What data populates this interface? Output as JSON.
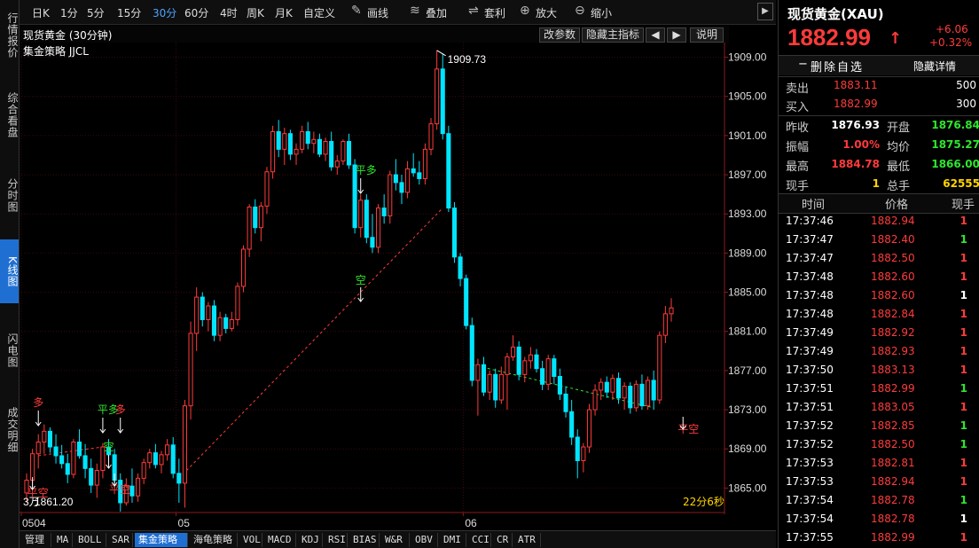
{
  "sidebar": {
    "tabs": [
      {
        "label": "行情报价",
        "active": false
      },
      {
        "label": "综合看盘",
        "active": false
      },
      {
        "label": "分时图",
        "active": false
      },
      {
        "label": "K线图",
        "active": true
      },
      {
        "label": "闪电图",
        "active": false
      },
      {
        "label": "成交明细",
        "active": false
      }
    ]
  },
  "toolbar": {
    "periods": [
      "日K",
      "1分",
      "5分",
      "15分",
      "30分",
      "60分",
      "4时",
      "周K",
      "月K",
      "自定义"
    ],
    "active_period": "30分",
    "tools": [
      {
        "label": "画线",
        "icon": "pencil-icon"
      },
      {
        "label": "叠加",
        "icon": "stack-icon"
      },
      {
        "label": "套利",
        "icon": "arbitrage-icon"
      },
      {
        "label": "放大",
        "icon": "zoom-in-icon"
      },
      {
        "label": "缩小",
        "icon": "zoom-out-icon"
      }
    ],
    "arrow": "▶"
  },
  "chart_header": {
    "title": "现货黄金 (30分钟)",
    "strategy": "集金策略 JJCL",
    "buttons": {
      "params": "改参数",
      "hide": "隐藏主指标",
      "left": "◀",
      "right": "▶",
      "help": "说明"
    }
  },
  "chart_data": {
    "type": "candlestick",
    "ylim": [
      1862.5,
      1910.5
    ],
    "yticks": [
      "1909.00",
      "1905.00",
      "1901.00",
      "1897.00",
      "1893.00",
      "1889.00",
      "1885.00",
      "1881.00",
      "1877.00",
      "1873.00",
      "1869.00",
      "1865.00"
    ],
    "xlabels": [
      "0504",
      "05",
      "06"
    ],
    "high_label": "1909.73",
    "low_label": "1861.20",
    "low_prefix": "3万",
    "countdown": "22分6秒",
    "signals": [
      {
        "text": "多",
        "color": "#ff3b3b"
      },
      {
        "text": "平空",
        "color": "#ff3b3b"
      },
      {
        "text": "平多",
        "color": "#2ee62e"
      },
      {
        "text": "多",
        "color": "#ff3b3b"
      },
      {
        "text": "空",
        "color": "#2ee62e"
      },
      {
        "text": "平空",
        "color": "#ff3b3b"
      },
      {
        "text": "平多",
        "color": "#2ee62e"
      },
      {
        "text": "空",
        "color": "#2ee62e"
      },
      {
        "text": "平空",
        "color": "#ff3b3b"
      }
    ],
    "colors": {
      "up": "#ff3b3b",
      "down": "#00e5ff",
      "grid": "#3a0a0a",
      "axis": "#8b1a1a"
    },
    "candles": [
      [
        1864.5,
        1866.5,
        1863.5,
        1865.8
      ],
      [
        1865.8,
        1869.0,
        1864.8,
        1868.5
      ],
      [
        1868.5,
        1870.5,
        1867.0,
        1869.7
      ],
      [
        1869.7,
        1871.5,
        1868.5,
        1870.8
      ],
      [
        1870.8,
        1871.2,
        1868.6,
        1869.2
      ],
      [
        1869.2,
        1870.5,
        1867.5,
        1868.3
      ],
      [
        1868.3,
        1869.4,
        1867.0,
        1867.5
      ],
      [
        1867.5,
        1868.5,
        1865.5,
        1866.4
      ],
      [
        1866.4,
        1870.0,
        1866.0,
        1869.7
      ],
      [
        1869.7,
        1871.0,
        1868.0,
        1868.3
      ],
      [
        1868.3,
        1869.5,
        1866.0,
        1867.0
      ],
      [
        1867.0,
        1868.0,
        1864.5,
        1865.3
      ],
      [
        1865.3,
        1867.5,
        1864.0,
        1866.8
      ],
      [
        1866.8,
        1869.6,
        1866.0,
        1869.2
      ],
      [
        1869.2,
        1870.0,
        1867.8,
        1868.4
      ],
      [
        1868.4,
        1869.0,
        1865.0,
        1865.8
      ],
      [
        1865.8,
        1866.5,
        1862.6,
        1863.5
      ],
      [
        1863.5,
        1866.0,
        1863.2,
        1865.2
      ],
      [
        1865.2,
        1867.0,
        1863.5,
        1864.2
      ],
      [
        1864.2,
        1866.5,
        1863.6,
        1866.0
      ],
      [
        1866.0,
        1868.0,
        1865.4,
        1867.6
      ],
      [
        1867.6,
        1869.0,
        1867.0,
        1868.6
      ],
      [
        1868.6,
        1869.5,
        1867.0,
        1867.4
      ],
      [
        1867.4,
        1868.8,
        1866.5,
        1868.4
      ],
      [
        1868.4,
        1870.0,
        1867.8,
        1869.4
      ],
      [
        1869.4,
        1870.2,
        1866.0,
        1866.5
      ],
      [
        1866.5,
        1868.0,
        1863.5,
        1865.5
      ],
      [
        1865.5,
        1874.0,
        1863.0,
        1873.4
      ],
      [
        1873.4,
        1882.0,
        1872.0,
        1880.8
      ],
      [
        1880.8,
        1885.5,
        1879.0,
        1884.5
      ],
      [
        1884.5,
        1885.0,
        1881.5,
        1882.2
      ],
      [
        1882.2,
        1884.0,
        1881.0,
        1883.6
      ],
      [
        1883.6,
        1884.2,
        1880.0,
        1880.6
      ],
      [
        1880.6,
        1883.0,
        1880.0,
        1882.4
      ],
      [
        1882.4,
        1882.8,
        1880.8,
        1881.3
      ],
      [
        1881.3,
        1883.0,
        1881.0,
        1882.2
      ],
      [
        1882.2,
        1886.0,
        1881.6,
        1885.6
      ],
      [
        1885.6,
        1889.8,
        1885.0,
        1889.4
      ],
      [
        1889.4,
        1894.0,
        1888.6,
        1893.7
      ],
      [
        1893.7,
        1894.5,
        1891.0,
        1891.6
      ],
      [
        1891.6,
        1894.2,
        1890.2,
        1893.8
      ],
      [
        1893.8,
        1897.8,
        1893.0,
        1897.3
      ],
      [
        1897.3,
        1902.0,
        1896.6,
        1901.4
      ],
      [
        1901.4,
        1902.6,
        1898.8,
        1899.6
      ],
      [
        1899.6,
        1901.8,
        1898.0,
        1901.2
      ],
      [
        1901.2,
        1901.6,
        1898.5,
        1899.1
      ],
      [
        1899.1,
        1900.2,
        1898.0,
        1899.6
      ],
      [
        1899.6,
        1902.0,
        1899.2,
        1901.4
      ],
      [
        1901.4,
        1902.4,
        1899.6,
        1900.2
      ],
      [
        1900.2,
        1901.4,
        1899.2,
        1900.6
      ],
      [
        1900.6,
        1901.2,
        1898.8,
        1899.1
      ],
      [
        1899.1,
        1900.8,
        1898.4,
        1900.4
      ],
      [
        1900.4,
        1901.4,
        1897.4,
        1897.8
      ],
      [
        1897.8,
        1899.0,
        1897.0,
        1898.4
      ],
      [
        1898.4,
        1900.6,
        1898.0,
        1900.4
      ],
      [
        1900.4,
        1901.2,
        1897.6,
        1898.0
      ],
      [
        1898.0,
        1898.6,
        1891.0,
        1891.6
      ],
      [
        1891.6,
        1895.0,
        1890.6,
        1894.4
      ],
      [
        1894.4,
        1895.0,
        1890.0,
        1890.6
      ],
      [
        1890.6,
        1893.0,
        1889.0,
        1889.6
      ],
      [
        1889.6,
        1894.0,
        1889.0,
        1893.6
      ],
      [
        1893.6,
        1895.0,
        1892.0,
        1892.8
      ],
      [
        1892.8,
        1897.4,
        1892.0,
        1897.0
      ],
      [
        1897.0,
        1898.6,
        1895.4,
        1896.2
      ],
      [
        1896.2,
        1897.0,
        1894.0,
        1895.2
      ],
      [
        1895.2,
        1898.4,
        1894.6,
        1897.6
      ],
      [
        1897.6,
        1899.2,
        1896.8,
        1897.2
      ],
      [
        1897.2,
        1898.4,
        1896.0,
        1896.6
      ],
      [
        1896.6,
        1900.2,
        1896.0,
        1899.6
      ],
      [
        1899.6,
        1902.8,
        1899.0,
        1902.2
      ],
      [
        1902.2,
        1909.7,
        1901.6,
        1907.8
      ],
      [
        1907.8,
        1909.4,
        1900.6,
        1901.2
      ],
      [
        1901.2,
        1902.0,
        1893.2,
        1893.6
      ],
      [
        1893.6,
        1894.2,
        1888.0,
        1888.6
      ],
      [
        1888.6,
        1889.0,
        1885.6,
        1886.4
      ],
      [
        1886.4,
        1886.8,
        1881.2,
        1881.6
      ],
      [
        1881.6,
        1882.4,
        1875.4,
        1876.0
      ],
      [
        1876.0,
        1878.2,
        1872.4,
        1877.6
      ],
      [
        1877.6,
        1878.4,
        1874.4,
        1874.8
      ],
      [
        1874.8,
        1877.0,
        1874.0,
        1876.6
      ],
      [
        1876.6,
        1877.2,
        1873.2,
        1874.0
      ],
      [
        1874.0,
        1877.4,
        1873.6,
        1876.6
      ],
      [
        1876.6,
        1878.8,
        1873.0,
        1878.4
      ],
      [
        1878.4,
        1880.6,
        1878.0,
        1879.4
      ],
      [
        1879.4,
        1880.0,
        1876.0,
        1876.6
      ],
      [
        1876.6,
        1878.4,
        1875.8,
        1878.0
      ],
      [
        1878.0,
        1879.4,
        1877.2,
        1878.6
      ],
      [
        1878.6,
        1879.2,
        1876.8,
        1877.2
      ],
      [
        1877.2,
        1878.0,
        1875.0,
        1875.6
      ],
      [
        1875.6,
        1878.6,
        1875.0,
        1878.2
      ],
      [
        1878.2,
        1878.6,
        1875.6,
        1876.4
      ],
      [
        1876.4,
        1877.2,
        1874.0,
        1874.6
      ],
      [
        1874.6,
        1875.4,
        1872.2,
        1872.8
      ],
      [
        1872.8,
        1874.0,
        1869.4,
        1870.2
      ],
      [
        1870.2,
        1871.0,
        1866.0,
        1867.8
      ],
      [
        1867.8,
        1869.6,
        1866.6,
        1869.2
      ],
      [
        1869.2,
        1873.6,
        1868.6,
        1873.0
      ],
      [
        1873.0,
        1875.6,
        1872.4,
        1875.0
      ],
      [
        1875.0,
        1876.2,
        1874.0,
        1875.8
      ],
      [
        1875.8,
        1876.4,
        1874.2,
        1874.8
      ],
      [
        1874.8,
        1876.6,
        1874.0,
        1876.2
      ],
      [
        1876.2,
        1876.8,
        1873.6,
        1874.2
      ],
      [
        1874.2,
        1875.8,
        1873.0,
        1875.4
      ],
      [
        1875.4,
        1875.8,
        1872.6,
        1873.2
      ],
      [
        1873.2,
        1876.0,
        1872.8,
        1875.6
      ],
      [
        1875.6,
        1876.6,
        1873.0,
        1873.4
      ],
      [
        1873.4,
        1876.4,
        1873.0,
        1876.0
      ],
      [
        1876.0,
        1877.0,
        1873.0,
        1874.0
      ],
      [
        1874.0,
        1881.0,
        1873.6,
        1880.6
      ],
      [
        1880.6,
        1883.6,
        1879.8,
        1882.8
      ],
      [
        1882.8,
        1884.4,
        1882.0,
        1883.4
      ]
    ]
  },
  "bottom_tabs": {
    "items": [
      "管理",
      "MA",
      "BOLL",
      "SAR",
      "集金策略",
      "海龟策略",
      "VOL",
      "MACD",
      "KDJ",
      "RSI",
      "BIAS",
      "W&R",
      "OBV",
      "DMI",
      "CCI",
      "CR",
      "ATR"
    ],
    "active": "集金策略"
  },
  "quote": {
    "name": "现货黄金(XAU)",
    "price": "1882.99",
    "arrow": "↑",
    "change": "+6.06",
    "change_pct": "+0.32%",
    "remove_btn": "删除自选",
    "hide_btn": "隐藏详情",
    "sell_label": "卖出",
    "sell_price": "1883.11",
    "sell_qty": "500",
    "buy_label": "买入",
    "buy_price": "1882.99",
    "buy_qty": "300",
    "stats": [
      [
        {
          "l": "昨收",
          "v": "1876.93",
          "c": "white"
        },
        {
          "l": "开盘",
          "v": "1876.84",
          "c": "green"
        }
      ],
      [
        {
          "l": "振幅",
          "v": "1.00%",
          "c": "red"
        },
        {
          "l": "均价",
          "v": "1875.27",
          "c": "green"
        }
      ],
      [
        {
          "l": "最高",
          "v": "1884.78",
          "c": "red"
        },
        {
          "l": "最低",
          "v": "1866.00",
          "c": "green"
        }
      ],
      [
        {
          "l": "现手",
          "v": "1",
          "c": "yellow"
        },
        {
          "l": "总手",
          "v": "62555",
          "c": "yellow"
        }
      ]
    ],
    "ticks_header": {
      "time": "时间",
      "price": "价格",
      "vol": "现手"
    },
    "ticks": [
      {
        "t": "17:37:46",
        "p": "1882.94",
        "v": "1",
        "vc": "red"
      },
      {
        "t": "17:37:47",
        "p": "1882.40",
        "v": "1",
        "vc": "green"
      },
      {
        "t": "17:37:47",
        "p": "1882.50",
        "v": "1",
        "vc": "red"
      },
      {
        "t": "17:37:48",
        "p": "1882.60",
        "v": "1",
        "vc": "red"
      },
      {
        "t": "17:37:48",
        "p": "1882.60",
        "v": "1",
        "vc": "white"
      },
      {
        "t": "17:37:48",
        "p": "1882.84",
        "v": "1",
        "vc": "red"
      },
      {
        "t": "17:37:49",
        "p": "1882.92",
        "v": "1",
        "vc": "red"
      },
      {
        "t": "17:37:49",
        "p": "1882.93",
        "v": "1",
        "vc": "red"
      },
      {
        "t": "17:37:50",
        "p": "1883.13",
        "v": "1",
        "vc": "red"
      },
      {
        "t": "17:37:51",
        "p": "1882.99",
        "v": "1",
        "vc": "green"
      },
      {
        "t": "17:37:51",
        "p": "1883.05",
        "v": "1",
        "vc": "red"
      },
      {
        "t": "17:37:52",
        "p": "1882.85",
        "v": "1",
        "vc": "green"
      },
      {
        "t": "17:37:52",
        "p": "1882.50",
        "v": "1",
        "vc": "green"
      },
      {
        "t": "17:37:53",
        "p": "1882.81",
        "v": "1",
        "vc": "red"
      },
      {
        "t": "17:37:53",
        "p": "1882.94",
        "v": "1",
        "vc": "red"
      },
      {
        "t": "17:37:54",
        "p": "1882.78",
        "v": "1",
        "vc": "green"
      },
      {
        "t": "17:37:54",
        "p": "1882.78",
        "v": "1",
        "vc": "white"
      },
      {
        "t": "17:37:55",
        "p": "1882.99",
        "v": "1",
        "vc": "red"
      }
    ]
  }
}
